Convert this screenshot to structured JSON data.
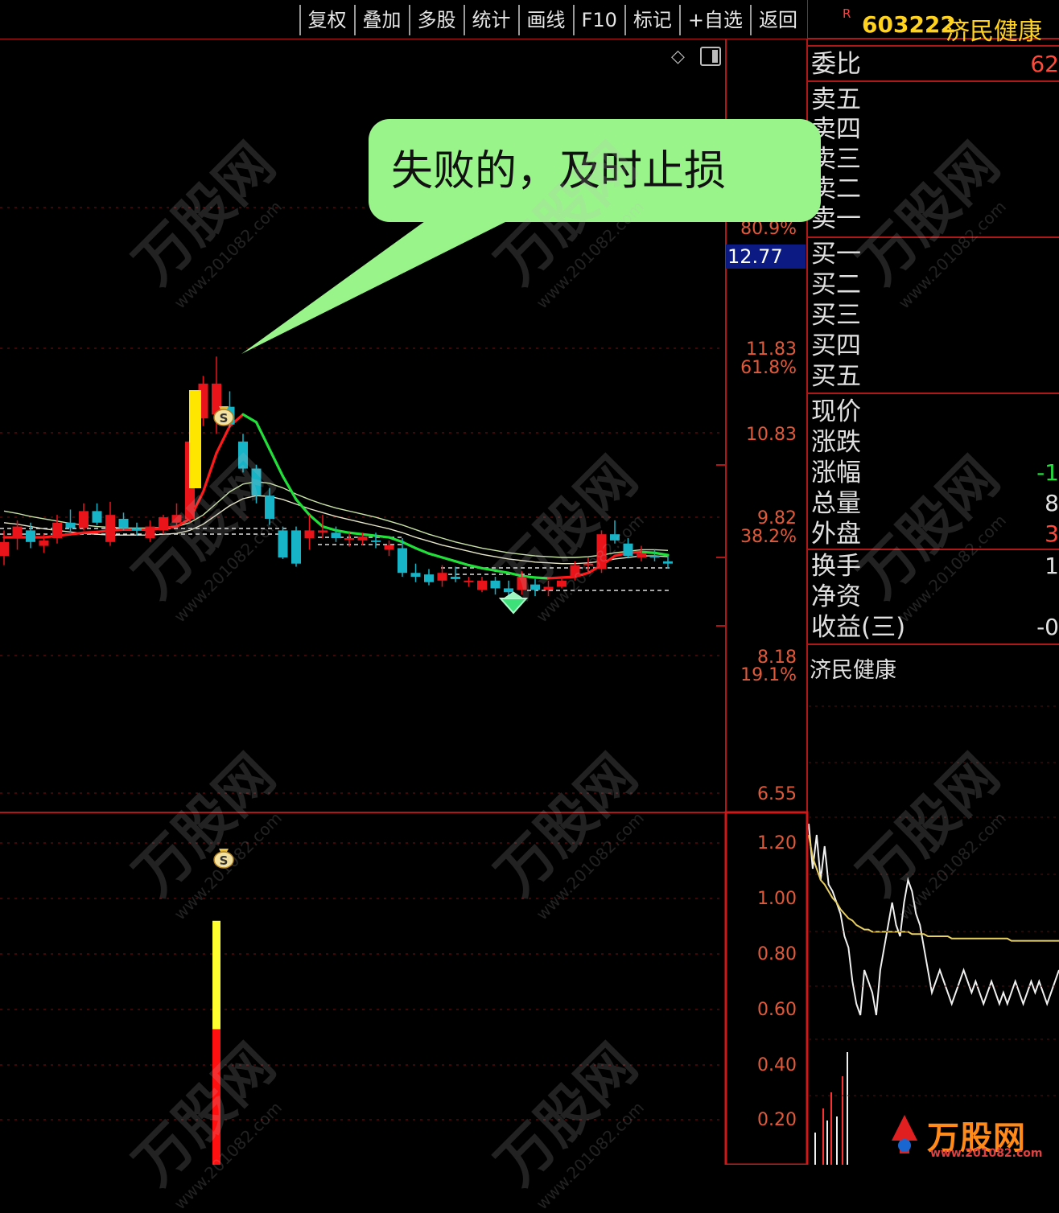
{
  "toolbar": {
    "buttons": [
      "复权",
      "叠加",
      "多股",
      "统计",
      "画线",
      "F10",
      "标记",
      "+自选",
      "返回"
    ]
  },
  "quote": {
    "badge": "R",
    "code": "603222",
    "name": "济民健康",
    "weibi_label": "委比",
    "weibi_value": "62",
    "asks": [
      "卖五",
      "卖四",
      "卖三",
      "卖二",
      "卖一"
    ],
    "bids": [
      "买一",
      "买二",
      "买三",
      "买四",
      "买五"
    ],
    "stats": [
      {
        "label": "现价",
        "value": ""
      },
      {
        "label": "涨跌",
        "value": ""
      },
      {
        "label": "涨幅",
        "value": "-1"
      },
      {
        "label": "总量",
        "value": "8"
      },
      {
        "label": "外盘",
        "value": "3"
      }
    ],
    "stats2": [
      {
        "label": "换手",
        "value": "1"
      },
      {
        "label": "净资",
        "value": ""
      },
      {
        "label": "收益(三)",
        "value": "-0"
      }
    ],
    "intraday_title": "济民健康"
  },
  "price_axis": {
    "current": "12.77",
    "labels": [
      {
        "price": "80.9%"
      },
      {
        "price": "11.83",
        "pct": "61.8%"
      },
      {
        "price": "10.83"
      },
      {
        "price": "9.82",
        "pct": "38.2%"
      },
      {
        "price": "8.18",
        "pct": "19.1%"
      },
      {
        "price": "6.55"
      }
    ]
  },
  "volume_axis": [
    "1.20",
    "1.00",
    "0.80",
    "0.60",
    "0.40",
    "0.20"
  ],
  "annotation": "失败的，及时止损",
  "watermark": {
    "brand": "万股网",
    "url": "www.201082.com"
  },
  "colors": {
    "up": "#e8141a",
    "down": "#17b3c7",
    "ma_fast_up": "#ff1a1a",
    "ma_fast_down": "#22e03a",
    "callout": "#99f58a",
    "axis": "#b01818"
  },
  "chart_data": {
    "type": "candlestick",
    "price_ylim": [
      6.55,
      12.9
    ],
    "candles": [
      {
        "o": 9.62,
        "h": 9.95,
        "l": 9.5,
        "c": 9.8
      },
      {
        "o": 9.85,
        "h": 10.08,
        "l": 9.7,
        "c": 10.0
      },
      {
        "o": 9.95,
        "h": 10.05,
        "l": 9.72,
        "c": 9.8
      },
      {
        "o": 9.75,
        "h": 9.9,
        "l": 9.66,
        "c": 9.82
      },
      {
        "o": 9.85,
        "h": 10.15,
        "l": 9.78,
        "c": 10.05
      },
      {
        "o": 10.05,
        "h": 10.22,
        "l": 9.92,
        "c": 9.98
      },
      {
        "o": 9.98,
        "h": 10.3,
        "l": 9.95,
        "c": 10.2
      },
      {
        "o": 10.2,
        "h": 10.3,
        "l": 10.02,
        "c": 10.05
      },
      {
        "o": 9.8,
        "h": 10.32,
        "l": 9.75,
        "c": 10.15
      },
      {
        "o": 10.1,
        "h": 10.18,
        "l": 9.95,
        "c": 9.98
      },
      {
        "o": 9.98,
        "h": 10.05,
        "l": 9.88,
        "c": 9.95
      },
      {
        "o": 9.85,
        "h": 10.08,
        "l": 9.8,
        "c": 10.0
      },
      {
        "o": 9.95,
        "h": 10.15,
        "l": 9.9,
        "c": 10.12
      },
      {
        "o": 10.05,
        "h": 10.3,
        "l": 9.98,
        "c": 10.15
      },
      {
        "o": 10.1,
        "h": 11.1,
        "l": 10.05,
        "c": 11.1
      },
      {
        "o": 11.4,
        "h": 11.95,
        "l": 11.3,
        "c": 11.85
      },
      {
        "o": 11.45,
        "h": 12.2,
        "l": 11.2,
        "c": 11.85
      },
      {
        "o": 11.55,
        "h": 11.75,
        "l": 11.28,
        "c": 11.32
      },
      {
        "o": 11.1,
        "h": 11.2,
        "l": 10.7,
        "c": 10.75
      },
      {
        "o": 10.75,
        "h": 10.8,
        "l": 10.3,
        "c": 10.4
      },
      {
        "o": 10.4,
        "h": 10.5,
        "l": 10.02,
        "c": 10.1
      },
      {
        "o": 9.95,
        "h": 10.0,
        "l": 9.58,
        "c": 9.6
      },
      {
        "o": 9.95,
        "h": 10.0,
        "l": 9.48,
        "c": 9.52
      },
      {
        "o": 9.85,
        "h": 10.15,
        "l": 9.7,
        "c": 9.95
      },
      {
        "o": 9.92,
        "h": 10.15,
        "l": 9.85,
        "c": 9.95
      },
      {
        "o": 9.92,
        "h": 10.0,
        "l": 9.8,
        "c": 9.85
      },
      {
        "o": 9.85,
        "h": 9.92,
        "l": 9.74,
        "c": 9.85
      },
      {
        "o": 9.82,
        "h": 9.92,
        "l": 9.76,
        "c": 9.87
      },
      {
        "o": 9.82,
        "h": 9.92,
        "l": 9.72,
        "c": 9.8
      },
      {
        "o": 9.7,
        "h": 9.82,
        "l": 9.62,
        "c": 9.76
      },
      {
        "o": 9.72,
        "h": 9.85,
        "l": 9.35,
        "c": 9.4
      },
      {
        "o": 9.4,
        "h": 9.52,
        "l": 9.28,
        "c": 9.35
      },
      {
        "o": 9.38,
        "h": 9.45,
        "l": 9.24,
        "c": 9.28
      },
      {
        "o": 9.3,
        "h": 9.5,
        "l": 9.22,
        "c": 9.4
      },
      {
        "o": 9.35,
        "h": 9.48,
        "l": 9.28,
        "c": 9.32
      },
      {
        "o": 9.3,
        "h": 9.35,
        "l": 9.22,
        "c": 9.3
      },
      {
        "o": 9.18,
        "h": 9.35,
        "l": 9.15,
        "c": 9.3
      },
      {
        "o": 9.3,
        "h": 9.35,
        "l": 9.12,
        "c": 9.2
      },
      {
        "o": 9.2,
        "h": 9.3,
        "l": 9.05,
        "c": 9.15
      },
      {
        "o": 9.18,
        "h": 9.42,
        "l": 9.12,
        "c": 9.35
      },
      {
        "o": 9.25,
        "h": 9.32,
        "l": 9.1,
        "c": 9.18
      },
      {
        "o": 9.18,
        "h": 9.3,
        "l": 9.1,
        "c": 9.22
      },
      {
        "o": 9.22,
        "h": 9.35,
        "l": 9.2,
        "c": 9.3
      },
      {
        "o": 9.35,
        "h": 9.55,
        "l": 9.3,
        "c": 9.5
      },
      {
        "o": 9.5,
        "h": 9.6,
        "l": 9.4,
        "c": 9.52
      },
      {
        "o": 9.45,
        "h": 9.95,
        "l": 9.4,
        "c": 9.9
      },
      {
        "o": 9.9,
        "h": 10.08,
        "l": 9.78,
        "c": 9.82
      },
      {
        "o": 9.78,
        "h": 9.85,
        "l": 9.6,
        "c": 9.62
      },
      {
        "o": 9.6,
        "h": 9.75,
        "l": 9.55,
        "c": 9.65
      },
      {
        "o": 9.62,
        "h": 9.7,
        "l": 9.55,
        "c": 9.6
      },
      {
        "o": 9.55,
        "h": 9.62,
        "l": 9.46,
        "c": 9.52
      }
    ],
    "ma_fast": [
      9.86,
      9.86,
      9.86,
      9.86,
      9.88,
      9.9,
      9.92,
      9.93,
      9.95,
      9.96,
      9.96,
      9.96,
      9.98,
      10.0,
      10.1,
      10.45,
      10.95,
      11.3,
      11.45,
      11.35,
      11.0,
      10.65,
      10.35,
      10.15,
      10.0,
      9.95,
      9.92,
      9.9,
      9.88,
      9.86,
      9.8,
      9.72,
      9.65,
      9.6,
      9.55,
      9.5,
      9.46,
      9.43,
      9.4,
      9.36,
      9.34,
      9.33,
      9.34,
      9.35,
      9.4,
      9.5,
      9.62,
      9.66,
      9.67,
      9.66,
      9.63
    ],
    "ma_mid": [
      10.2,
      10.17,
      10.13,
      10.1,
      10.07,
      10.04,
      10.02,
      10.0,
      9.99,
      9.98,
      9.98,
      9.98,
      9.99,
      10.0,
      10.05,
      10.15,
      10.3,
      10.45,
      10.55,
      10.58,
      10.56,
      10.5,
      10.42,
      10.35,
      10.29,
      10.24,
      10.2,
      10.16,
      10.12,
      10.07,
      10.02,
      9.96,
      9.9,
      9.85,
      9.8,
      9.76,
      9.72,
      9.69,
      9.66,
      9.64,
      9.62,
      9.61,
      9.6,
      9.6,
      9.61,
      9.63,
      9.66,
      9.68,
      9.7,
      9.7,
      9.69
    ],
    "ma_slow": [
      10.05,
      10.03,
      10.0,
      9.97,
      9.95,
      9.93,
      9.91,
      9.9,
      9.89,
      9.89,
      9.89,
      9.89,
      9.9,
      9.91,
      9.95,
      10.03,
      10.15,
      10.27,
      10.36,
      10.4,
      10.39,
      10.35,
      10.29,
      10.23,
      10.18,
      10.13,
      10.09,
      10.05,
      10.01,
      9.97,
      9.92,
      9.86,
      9.81,
      9.76,
      9.72,
      9.68,
      9.64,
      9.61,
      9.58,
      9.56,
      9.54,
      9.53,
      9.52,
      9.52,
      9.53,
      9.55,
      9.58,
      9.6,
      9.62,
      9.62,
      9.61
    ],
    "volume": [
      {
        "i": 16,
        "value": 0.9,
        "upper_color": "#ffff30",
        "lower_value": 0.5,
        "lower_color": "#ff1010"
      }
    ],
    "volume_ylim": [
      0,
      1.3
    ],
    "intraday": {
      "price": [
        1.25,
        1.05,
        1.2,
        1.0,
        1.15,
        0.98,
        0.95,
        0.9,
        0.85,
        0.75,
        0.7,
        0.55,
        0.45,
        0.4,
        0.6,
        0.55,
        0.5,
        0.4,
        0.6,
        0.7,
        0.8,
        0.9,
        0.8,
        0.75,
        0.9,
        1.0,
        0.95,
        0.85,
        0.8,
        0.7,
        0.6,
        0.5,
        0.55,
        0.6,
        0.55,
        0.5,
        0.45,
        0.5,
        0.55,
        0.6,
        0.55,
        0.5,
        0.55,
        0.5,
        0.45,
        0.5,
        0.55,
        0.5,
        0.45,
        0.5,
        0.45,
        0.5,
        0.55,
        0.5,
        0.45,
        0.5,
        0.55,
        0.5,
        0.55,
        0.5,
        0.45,
        0.5,
        0.55,
        0.6
      ],
      "avg": [
        1.2,
        1.1,
        1.05,
        1.0,
        0.98,
        0.95,
        0.92,
        0.9,
        0.87,
        0.85,
        0.83,
        0.82,
        0.8,
        0.79,
        0.78,
        0.78,
        0.77,
        0.77,
        0.77,
        0.77,
        0.77,
        0.77,
        0.77,
        0.77,
        0.77,
        0.77,
        0.76,
        0.76,
        0.76,
        0.76,
        0.75,
        0.75,
        0.75,
        0.75,
        0.75,
        0.75,
        0.74,
        0.74,
        0.74,
        0.74,
        0.74,
        0.74,
        0.74,
        0.74,
        0.74,
        0.74,
        0.74,
        0.74,
        0.74,
        0.74,
        0.74,
        0.73,
        0.73,
        0.73,
        0.73,
        0.73,
        0.73,
        0.73,
        0.73,
        0.73,
        0.73,
        0.73,
        0.73,
        0.73
      ]
    }
  }
}
